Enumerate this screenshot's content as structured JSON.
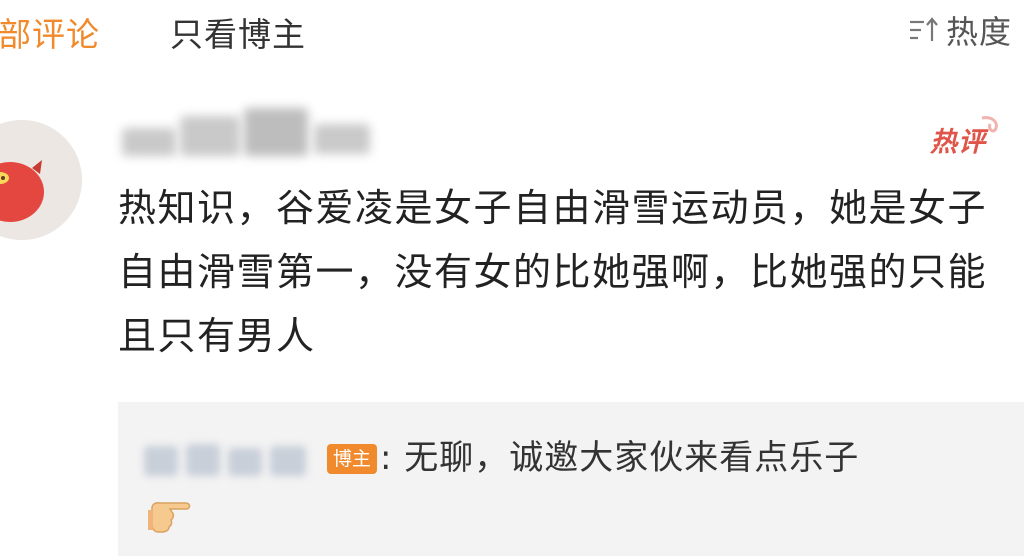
{
  "tabs": {
    "all_comments": "部评论",
    "blogger_only": "只看博主"
  },
  "sort": {
    "icon": "sort-lines-icon",
    "label": "热度"
  },
  "comment": {
    "hot_badge": "热评",
    "text": "热知识，谷爱凌是女子自由滑雪运动员，她是女子自由滑雪第一，没有女的比她强啊，比她强的只能且只有男人"
  },
  "reply": {
    "badge": "博主",
    "text": ": 无聊，诚邀大家伙来看点乐子",
    "emoji": "pointing-hand-icon"
  },
  "colors": {
    "accent": "#f08a2c",
    "hot": "#e0554a"
  }
}
